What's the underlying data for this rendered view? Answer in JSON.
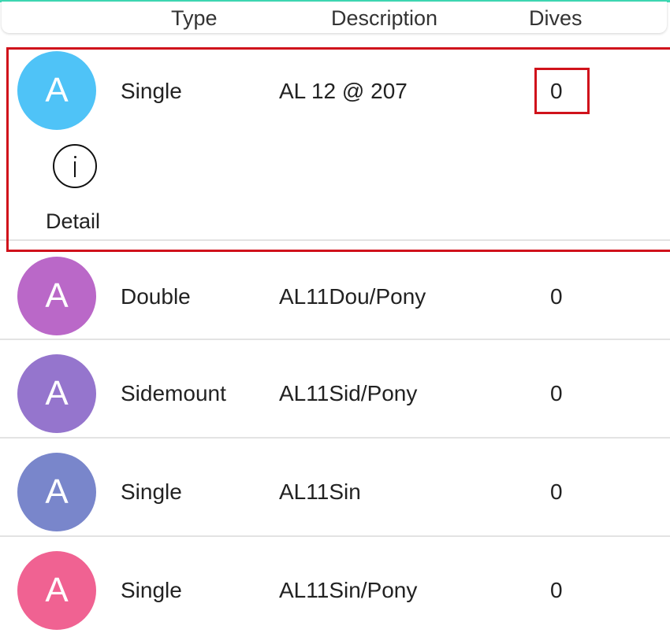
{
  "header": {
    "type_label": "Type",
    "description_label": "Description",
    "dives_label": "Dives"
  },
  "rows": [
    {
      "avatar_letter": "A",
      "avatar_color": "#4fc3f7",
      "type": "Single",
      "description": "AL 12 @ 207",
      "dives": "0"
    },
    {
      "avatar_letter": "A",
      "avatar_color": "#ba68c8",
      "type": "Double",
      "description": "AL11Dou/Pony",
      "dives": "0"
    },
    {
      "avatar_letter": "A",
      "avatar_color": "#9575cd",
      "type": "Sidemount",
      "description": "AL11Sid/Pony",
      "dives": "0"
    },
    {
      "avatar_letter": "A",
      "avatar_color": "#7986cb",
      "type": "Single",
      "description": "AL11Sin",
      "dives": "0"
    },
    {
      "avatar_letter": "A",
      "avatar_color": "#f06292",
      "type": "Single",
      "description": "AL11Sin/Pony",
      "dives": "0"
    }
  ],
  "expanded_row": {
    "detail_icon": "info-icon",
    "detail_label": "Detail"
  },
  "colors": {
    "accent": "#3ed9b4",
    "highlight": "#d0121b"
  }
}
